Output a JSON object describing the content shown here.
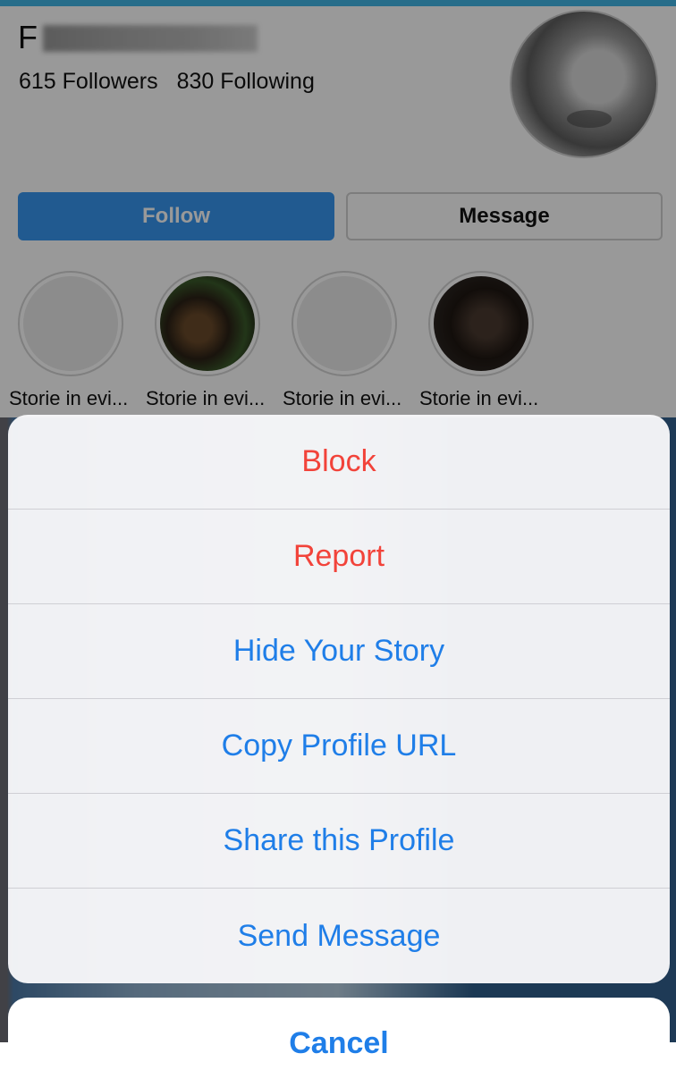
{
  "profile": {
    "name_visible": "F",
    "followers": "615 Followers",
    "following": "830 Following",
    "follow_label": "Follow",
    "message_label": "Message",
    "highlights": [
      {
        "label": "Storie in evi..."
      },
      {
        "label": "Storie in evi..."
      },
      {
        "label": "Storie in evi..."
      },
      {
        "label": "Storie in evi..."
      }
    ]
  },
  "action_sheet": {
    "items": [
      {
        "label": "Block",
        "style": "destructive"
      },
      {
        "label": "Report",
        "style": "destructive"
      },
      {
        "label": "Hide Your Story",
        "style": "normal"
      },
      {
        "label": "Copy Profile URL",
        "style": "normal"
      },
      {
        "label": "Share this Profile",
        "style": "normal"
      },
      {
        "label": "Send Message",
        "style": "normal"
      }
    ],
    "cancel_label": "Cancel"
  },
  "colors": {
    "destructive": "#f2433a",
    "action": "#1f7ee8",
    "follow_button": "#3897f0"
  }
}
